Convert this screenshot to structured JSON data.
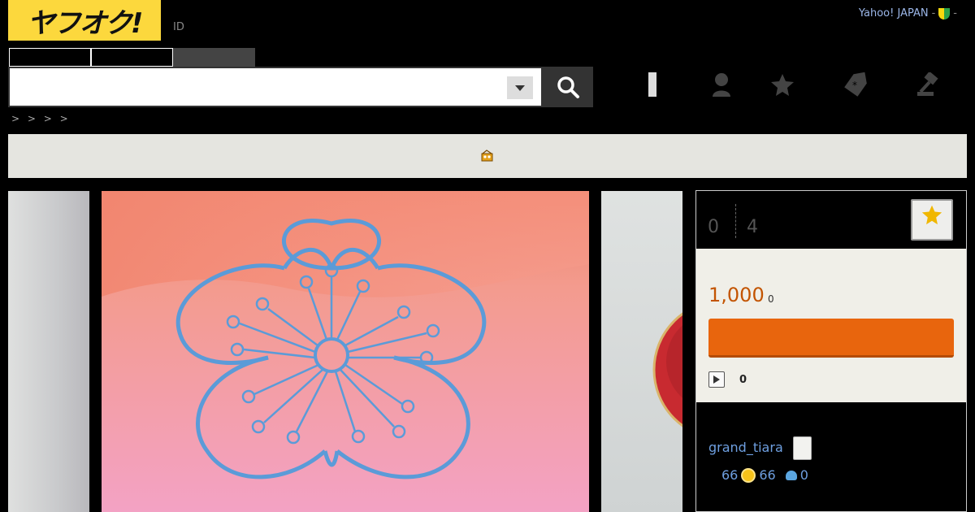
{
  "header": {
    "logo_text": "ヤフオク!",
    "id_link": "ID",
    "top_links": {
      "yahoo_japan": "Yahoo! JAPAN",
      "sep1": "-",
      "sep2": "-"
    }
  },
  "search": {
    "tabs": [
      "",
      "",
      ""
    ],
    "placeholder": "",
    "value": ""
  },
  "nav_icons": [
    "person-icon",
    "star-icon",
    "coupon-tag-icon",
    "auction-hammer-icon"
  ],
  "breadcrumb": "> > > >",
  "gallery": {
    "main_image": "plum-blossom-pattern"
  },
  "panel": {
    "stat_left": "0",
    "stat_right": "4",
    "price": "1,000",
    "price_sub": "0",
    "play_count": "0",
    "seller_name": "grand_tiara",
    "rating_total": "66",
    "rating_good": "66",
    "rating_bad": "0"
  },
  "colors": {
    "logo_yellow": "#fcd83d",
    "bid_orange": "#e8650d",
    "price_orange": "#c35400",
    "link_blue": "#6e9fe0"
  }
}
